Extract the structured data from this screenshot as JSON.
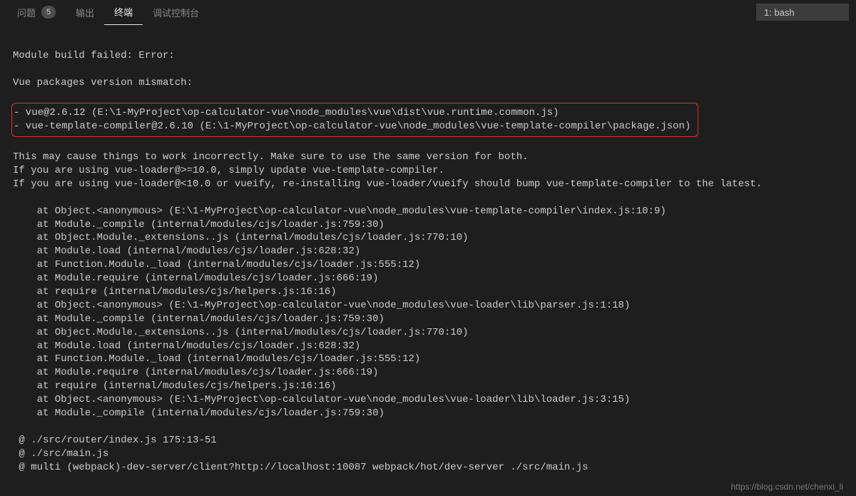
{
  "tabs": {
    "problems": "问题",
    "problems_count": "5",
    "output": "输出",
    "terminal": "终端",
    "debug_console": "调试控制台"
  },
  "dropdown": {
    "selected": "1: bash"
  },
  "terminal": {
    "line_blank": "",
    "line_build_failed": "Module build failed: Error:",
    "line_mismatch": "Vue packages version mismatch:",
    "box_line1": "- vue@2.6.12 (E:\\1-MyProject\\op-calculator-vue\\node_modules\\vue\\dist\\vue.runtime.common.js)",
    "box_line2": "- vue-template-compiler@2.6.10 (E:\\1-MyProject\\op-calculator-vue\\node_modules\\vue-template-compiler\\package.json)",
    "note1": "This may cause things to work incorrectly. Make sure to use the same version for both.",
    "note2": "If you are using vue-loader@>=10.0, simply update vue-template-compiler.",
    "note3": "If you are using vue-loader@<10.0 or vueify, re-installing vue-loader/vueify should bump vue-template-compiler to the latest.",
    "stack": [
      "    at Object.<anonymous> (E:\\1-MyProject\\op-calculator-vue\\node_modules\\vue-template-compiler\\index.js:10:9)",
      "    at Module._compile (internal/modules/cjs/loader.js:759:30)",
      "    at Object.Module._extensions..js (internal/modules/cjs/loader.js:770:10)",
      "    at Module.load (internal/modules/cjs/loader.js:628:32)",
      "    at Function.Module._load (internal/modules/cjs/loader.js:555:12)",
      "    at Module.require (internal/modules/cjs/loader.js:666:19)",
      "    at require (internal/modules/cjs/helpers.js:16:16)",
      "    at Object.<anonymous> (E:\\1-MyProject\\op-calculator-vue\\node_modules\\vue-loader\\lib\\parser.js:1:18)",
      "    at Module._compile (internal/modules/cjs/loader.js:759:30)",
      "    at Object.Module._extensions..js (internal/modules/cjs/loader.js:770:10)",
      "    at Module.load (internal/modules/cjs/loader.js:628:32)",
      "    at Function.Module._load (internal/modules/cjs/loader.js:555:12)",
      "    at Module.require (internal/modules/cjs/loader.js:666:19)",
      "    at require (internal/modules/cjs/helpers.js:16:16)",
      "    at Object.<anonymous> (E:\\1-MyProject\\op-calculator-vue\\node_modules\\vue-loader\\lib\\loader.js:3:15)",
      "    at Module._compile (internal/modules/cjs/loader.js:759:30)"
    ],
    "footer1": " @ ./src/router/index.js 175:13-51",
    "footer2": " @ ./src/main.js",
    "footer3": " @ multi (webpack)-dev-server/client?http://localhost:10087 webpack/hot/dev-server ./src/main.js"
  },
  "watermark": "https://blog.csdn.net/chenxi_li"
}
